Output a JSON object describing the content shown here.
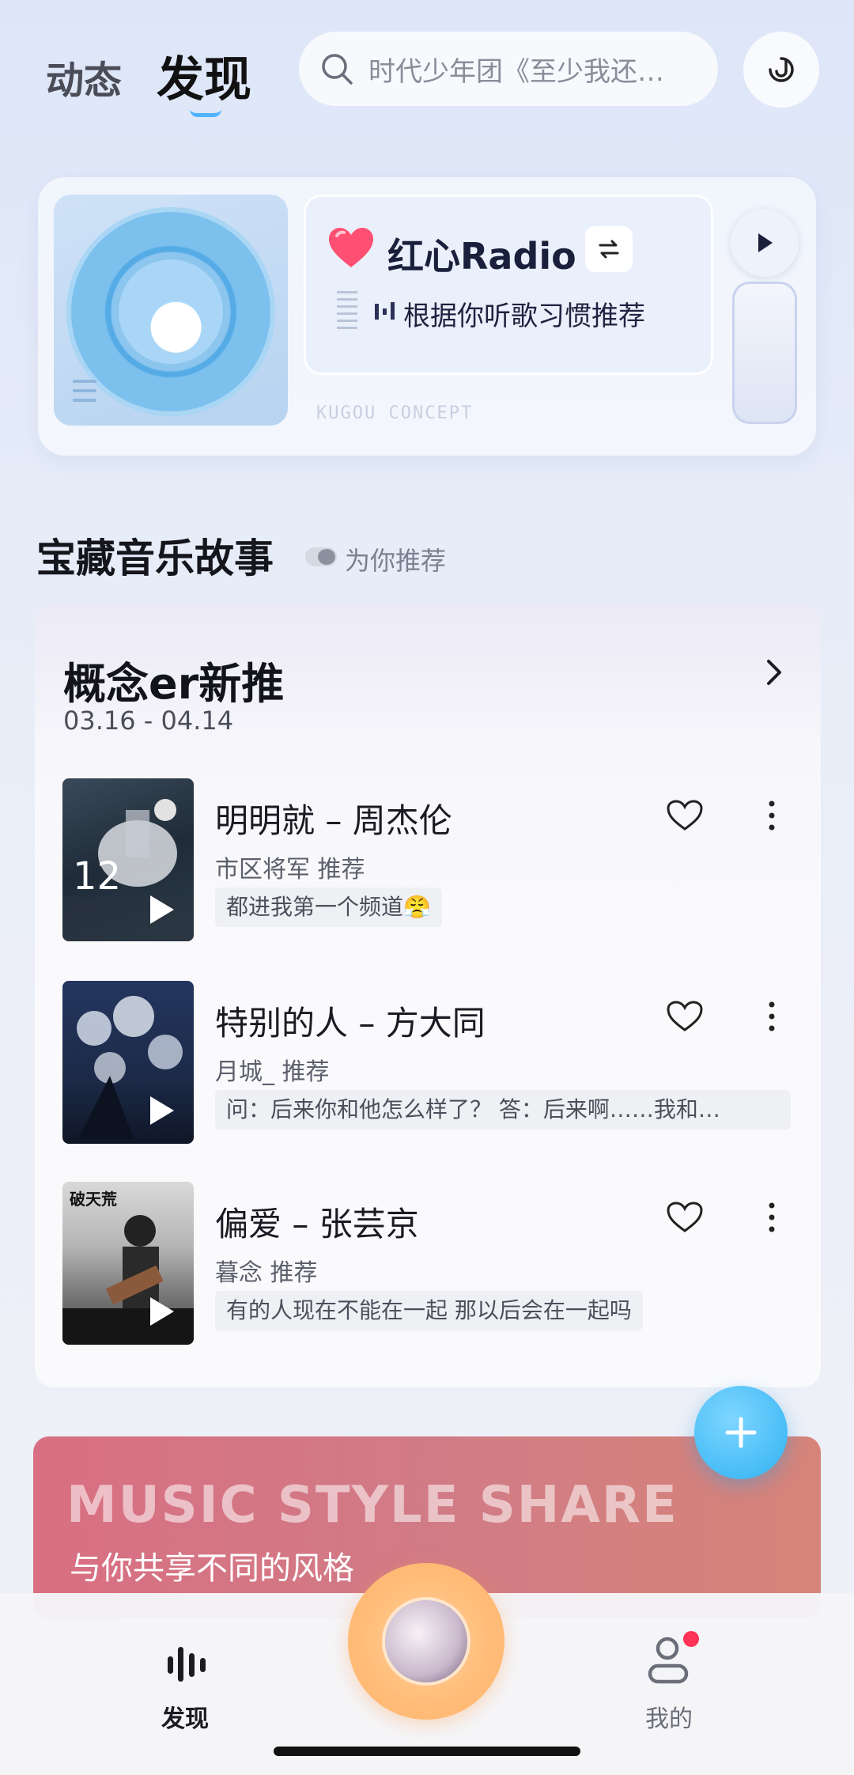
{
  "header": {
    "tabs": [
      {
        "label": "动态",
        "active": false
      },
      {
        "label": "发现",
        "active": true
      }
    ],
    "search_placeholder": "时代少年团《至少我还…",
    "listen_icon": "music-recognize-icon"
  },
  "radio": {
    "title": "红心Radio",
    "subtitle": "根据你听歌习惯推荐",
    "brand_text": "KUGOU CONCEPT",
    "heart_color": "#ff4f72"
  },
  "story": {
    "section_title": "宝藏音乐故事",
    "section_sub": "为你推荐",
    "card_title": "概念er新推",
    "date_range": "03.16 - 04.14",
    "songs": [
      {
        "title": "明明就 – 周杰伦",
        "recommender": "市区将军 推荐",
        "quote": "都进我第一个频道😤",
        "cover_text": "12"
      },
      {
        "title": "特别的人 – 方大同",
        "recommender": "月城_ 推荐",
        "quote": "问：后来你和他怎么样了？ 答：后来啊……我和…",
        "cover_text": ""
      },
      {
        "title": "偏爱 – 张芸京",
        "recommender": "暮念 推荐",
        "quote": "有的人现在不能在一起 那以后会在一起吗",
        "cover_text": "破天荒"
      }
    ]
  },
  "banner": {
    "title": "MUSIC STYLE SHARE",
    "subtitle": "与你共享不同的风格"
  },
  "bottom_nav": {
    "discover_label": "发现",
    "mine_label": "我的",
    "has_notification": true
  },
  "colors": {
    "accent_blue": "#2fb2f2",
    "banner_pink": "#d86f82",
    "center_orange": "#ffbd7a"
  }
}
